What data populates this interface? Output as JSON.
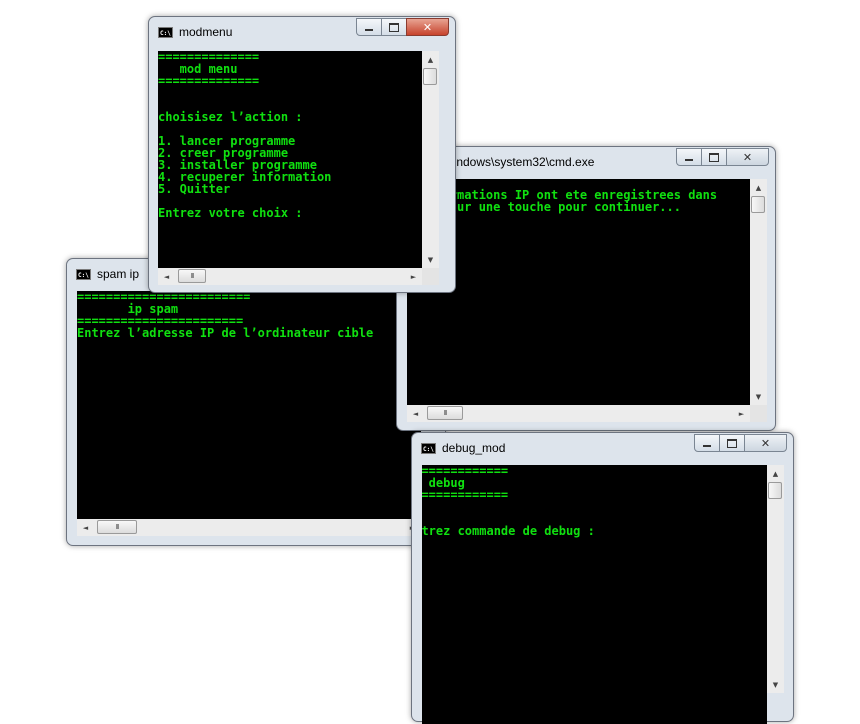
{
  "windows": {
    "spam": {
      "title": "spam ip",
      "lines": [
        "========================",
        "       ip spam",
        "=======================",
        "Entrez l’adresse IP de l’ordinateur cible"
      ]
    },
    "cmd": {
      "title": "C:\\Windows\\system32\\cmd.exe",
      "lines": [
        "Les informations IP ont ete enregistrees dans",
        "Appuyez sur une touche pour continuer..."
      ]
    },
    "debug": {
      "title": "debug_mod",
      "lines": [
        "==============",
        "   debug",
        "==============",
        "",
        "",
        "Entrez commande de debug :"
      ]
    },
    "modmenu": {
      "title": "modmenu",
      "lines": [
        "==============",
        "   mod menu",
        "==============",
        "",
        "",
        "choisisez l’action :",
        "",
        "1. lancer programme",
        "2. creer programme",
        "3. installer programme",
        "4. recuperer information",
        "5. Quitter",
        "",
        "Entrez votre choix :"
      ]
    }
  },
  "controls": {
    "minimize": "–",
    "maximize": "□",
    "close": "✕"
  },
  "scroll": {
    "up": "▲",
    "down": "▼",
    "left": "◄",
    "right": "►",
    "grip": "III"
  },
  "icon_text": "C:\\"
}
